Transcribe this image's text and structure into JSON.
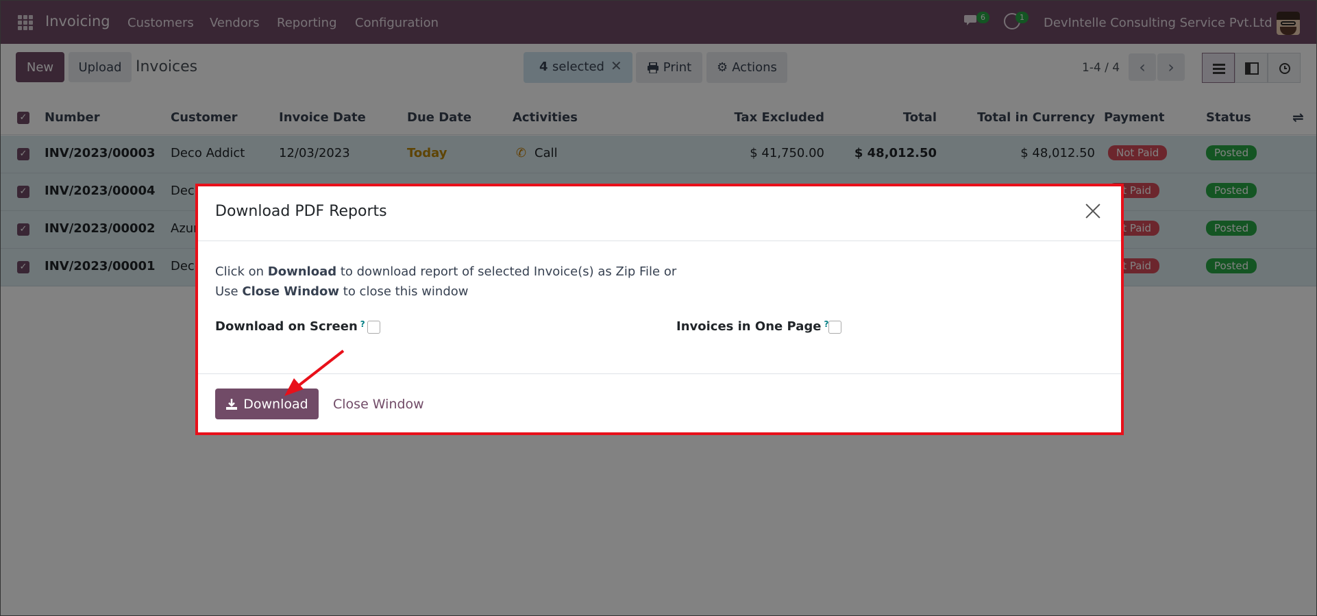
{
  "navbar": {
    "app_name": "Invoicing",
    "menu": [
      "Customers",
      "Vendors",
      "Reporting",
      "Configuration"
    ],
    "chat_count": "6",
    "activity_count": "1",
    "company": "DevIntelle Consulting Service Pvt.Ltd"
  },
  "control": {
    "new_label": "New",
    "upload_label": "Upload",
    "title": "Invoices",
    "selected_count": "4",
    "selected_text": "selected",
    "print_label": "Print",
    "actions_label": "Actions",
    "pager": "1-4 / 4"
  },
  "table": {
    "columns": [
      "Number",
      "Customer",
      "Invoice Date",
      "Due Date",
      "Activities",
      "Tax Excluded",
      "Total",
      "Total in Currency",
      "Payment",
      "Status"
    ],
    "rows": [
      {
        "number": "INV/2023/00003",
        "customer": "Deco Addict",
        "invoice_date": "12/03/2023",
        "due_date": "Today",
        "activity": "Call",
        "tax_excluded": "$ 41,750.00",
        "total": "$ 48,012.50",
        "total_currency": "$ 48,012.50",
        "payment": "Not Paid",
        "status": "Posted"
      },
      {
        "number": "INV/2023/00004",
        "customer": "Deco",
        "payment": "ot Paid",
        "status": "Posted"
      },
      {
        "number": "INV/2023/00002",
        "customer": "Azur",
        "payment": "ot Paid",
        "status": "Posted"
      },
      {
        "number": "INV/2023/00001",
        "customer": "Deco",
        "payment": "ot Paid",
        "status": "Posted"
      }
    ]
  },
  "modal": {
    "title": "Download PDF Reports",
    "line1_pre": "Click on",
    "line1_bold": "Download",
    "line1_post": "to download report of selected Invoice(s) as Zip File or",
    "line2_pre": "Use",
    "line2_bold": "Close Window",
    "line2_post": "to close this window",
    "field1": "Download on Screen",
    "field2": "Invoices in One Page",
    "help_mark": "?",
    "download_label": "Download",
    "close_label": "Close Window"
  },
  "colors": {
    "brand": "#714b67",
    "highlight": "#e8101a",
    "posted": "#28a745",
    "not_paid": "#d44c59",
    "today": "#b8860b"
  }
}
